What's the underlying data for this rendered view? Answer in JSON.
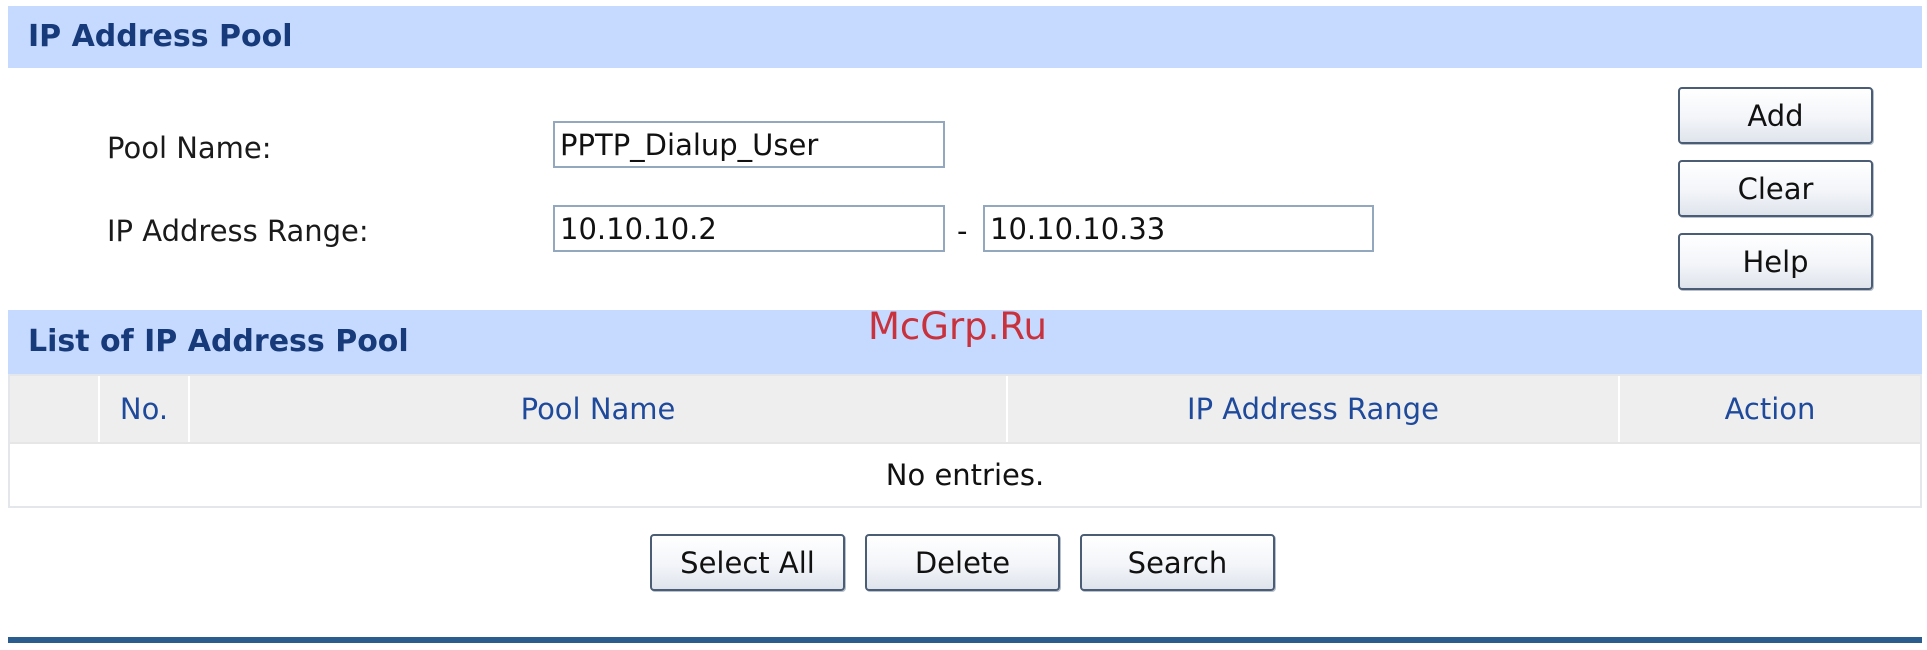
{
  "pool_section": {
    "title": "IP Address Pool",
    "pool_name_label": "Pool Name:",
    "pool_name_value": "PPTP_Dialup_User",
    "range_label": "IP Address Range:",
    "range_start": "10.10.10.2",
    "range_separator": "-",
    "range_end": "10.10.10.33"
  },
  "side_buttons": {
    "add": "Add",
    "clear": "Clear",
    "help": "Help"
  },
  "list_section": {
    "title": "List of IP Address Pool",
    "columns": [
      "",
      "No.",
      "Pool Name",
      "IP Address Range",
      "Action"
    ],
    "empty_message": "No entries."
  },
  "bottom_buttons": {
    "select_all": "Select All",
    "delete": "Delete",
    "search": "Search"
  },
  "watermark": "McGrp.Ru",
  "colors": {
    "header_bg": "#c6d9ff",
    "header_text": "#173a7a",
    "column_text": "#1f4a9c",
    "footer_line": "#2a5c8e",
    "watermark": "#c8323c"
  }
}
